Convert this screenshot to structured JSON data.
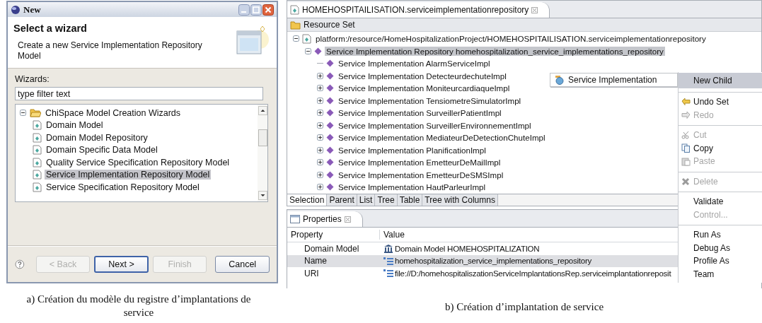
{
  "wizard_dialog": {
    "title": "New",
    "heading": "Select a wizard",
    "description": "Create a new Service Implementation Repository Model",
    "filter_label": "Wizards:",
    "filter": {
      "value": "type filter text"
    },
    "tree": [
      {
        "label": "ChiSpace Model Creation Wizards",
        "expanded": true,
        "selected": false,
        "children": [
          {
            "label": "Domain Model",
            "selected": false
          },
          {
            "label": "Domain Model Repository",
            "selected": false
          },
          {
            "label": "Domain Specific Data Model",
            "selected": false
          },
          {
            "label": "Quality Service Specification Repository Model",
            "selected": false
          },
          {
            "label": "Service Implementation Repository Model",
            "selected": true
          },
          {
            "label": "Service Specification Repository Model",
            "selected": false
          }
        ]
      }
    ],
    "buttons": [
      {
        "label": "< Back",
        "disabled": true,
        "default": false
      },
      {
        "label": "Next >",
        "disabled": false,
        "default": true
      },
      {
        "label": "Finish",
        "disabled": true,
        "default": false
      },
      {
        "label": "Cancel",
        "disabled": false,
        "default": false
      }
    ]
  },
  "caption_a": "a) Création du modèle du registre d’implantations de service",
  "editor": {
    "tab": "HOMEHOSPITAILISATION.serviceimplementationrepository",
    "toolbar": "Resource Set",
    "tree": [
      {
        "label": "platform:/resource/HomeHospitalizationProject/HOMEHOSPITAILISATION.serviceimplementationrepository",
        "kind": "expanded",
        "selected": false,
        "children": [
          {
            "label": "Service Implementation Repository homehospitalization_service_implementations_repository",
            "kind": "expanded",
            "selected": true,
            "children": [
              {
                "label": "Service Implementation AlarmServiceImpl",
                "kind": "leaf",
                "selected": false
              },
              {
                "label": "Service Implementation DetecteurdechuteImpl",
                "kind": "collapsed",
                "selected": false
              },
              {
                "label": "Service Implementation MoniteurcardiaqueImpl",
                "kind": "collapsed",
                "selected": false
              },
              {
                "label": "Service Implementation TensiometreSimulatorImpl",
                "kind": "collapsed",
                "selected": false
              },
              {
                "label": "Service Implementation SurveillerPatientImpl",
                "kind": "collapsed",
                "selected": false
              },
              {
                "label": "Service Implementation SurveillerEnvironnementImpl",
                "kind": "collapsed",
                "selected": false
              },
              {
                "label": "Service Implementation MediateurDeDetectionChuteImpl",
                "kind": "collapsed",
                "selected": false
              },
              {
                "label": "Service Implementation PlanificationImpl",
                "kind": "collapsed",
                "selected": false
              },
              {
                "label": "Service Implementation EmetteurDeMailImpl",
                "kind": "collapsed",
                "selected": false
              },
              {
                "label": "Service Implementation EmetteurDeSMSImpl",
                "kind": "collapsed",
                "selected": false
              },
              {
                "label": "Service Implementation HautParleurImpl",
                "kind": "collapsed",
                "selected": false
              }
            ]
          }
        ]
      }
    ],
    "view_tabs": [
      {
        "label": "Selection",
        "selected": true
      },
      {
        "label": "Parent",
        "selected": false
      },
      {
        "label": "List",
        "selected": false
      },
      {
        "label": "Tree",
        "selected": false
      },
      {
        "label": "Table",
        "selected": false
      },
      {
        "label": "Tree with Columns",
        "selected": false
      }
    ]
  },
  "submenu": {
    "label": "Service Implementation"
  },
  "context_menu": {
    "groups": [
      [
        {
          "label": "New Child",
          "disabled": false,
          "selected": true
        }
      ],
      [
        {
          "label": "Undo Set",
          "disabled": false,
          "selected": false
        },
        {
          "label": "Redo",
          "disabled": true,
          "selected": false
        }
      ],
      [
        {
          "label": "Cut",
          "disabled": true,
          "selected": false
        },
        {
          "label": "Copy",
          "disabled": false,
          "selected": false
        },
        {
          "label": "Paste",
          "disabled": true,
          "selected": false
        }
      ],
      [
        {
          "label": "Delete",
          "disabled": true,
          "selected": false
        }
      ],
      [
        {
          "label": "Validate",
          "disabled": false,
          "selected": false
        },
        {
          "label": "Control...",
          "disabled": true,
          "selected": false
        }
      ],
      [
        {
          "label": "Run As",
          "disabled": false,
          "selected": false
        },
        {
          "label": "Debug As",
          "disabled": false,
          "selected": false
        },
        {
          "label": "Profile As",
          "disabled": false,
          "selected": false
        },
        {
          "label": "Team",
          "disabled": false,
          "selected": false
        }
      ]
    ]
  },
  "properties": {
    "tab": "Properties",
    "columns": [
      "Property",
      "Value"
    ],
    "rows": [
      {
        "property": "Domain Model",
        "value": "Domain Model HOMEHOSPITALIZATION",
        "kind": "reference",
        "selected": false
      },
      {
        "property": "Name",
        "value": "homehospitalization_service_implementations_repository",
        "kind": "attribute",
        "selected": true
      },
      {
        "property": "URI",
        "value": "file://D:/homehospitaliszationServiceImplantationsRep.serviceimplantationreposit",
        "kind": "attribute",
        "selected": false
      }
    ]
  },
  "caption_b": "b) Création d’implantation de service"
}
